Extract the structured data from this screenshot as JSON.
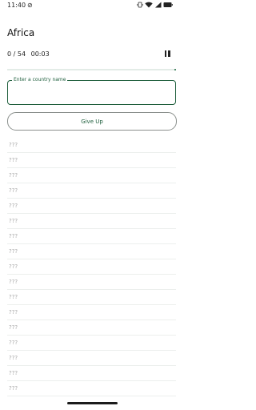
{
  "status_bar": {
    "time": "11:40"
  },
  "title": "Africa",
  "progress": {
    "count": "0 / 54",
    "timer": "00:03",
    "fraction": 0.0
  },
  "input": {
    "label": "Enter a country name",
    "value": ""
  },
  "give_up_label": "Give Up",
  "answers": [
    "???",
    "???",
    "???",
    "???",
    "???",
    "???",
    "???",
    "???",
    "???",
    "???",
    "???",
    "???",
    "???",
    "???",
    "???",
    "???",
    "???"
  ],
  "colors": {
    "accent": "#1f5f3d",
    "placeholder_text": "#a9a9a9"
  }
}
